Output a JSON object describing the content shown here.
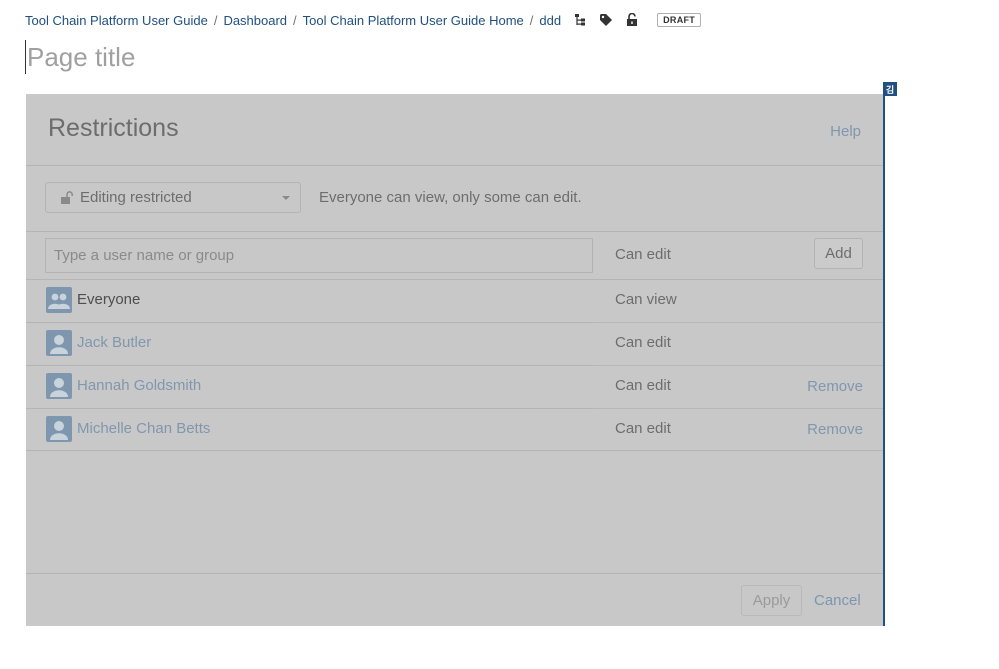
{
  "breadcrumb": {
    "items": [
      "Tool Chain Platform User Guide",
      "Dashboard",
      "Tool Chain Platform User Guide Home",
      "ddd"
    ],
    "separator": "/",
    "tools": [
      "page-tree-icon",
      "label-icon",
      "unlock-icon"
    ],
    "draft_badge": "DRAFT"
  },
  "page": {
    "title_placeholder": "Page title"
  },
  "corner_tag": "김",
  "dialog": {
    "title": "Restrictions",
    "help_label": "Help",
    "restriction_mode": "Editing restricted",
    "restriction_description": "Everyone can view, only some can edit.",
    "user_input_placeholder": "Type a user name or group",
    "permission_default": "Can edit",
    "add_label": "Add",
    "entries": [
      {
        "name": "Everyone",
        "permission": "Can view",
        "remove": "",
        "avatar": "group-avatar-icon"
      },
      {
        "name": "Jack Butler",
        "permission": "Can edit",
        "remove": "",
        "avatar": "user-avatar-icon"
      },
      {
        "name": "Hannah Goldsmith",
        "permission": "Can edit",
        "remove": "Remove",
        "avatar": "user-avatar-icon"
      },
      {
        "name": "Michelle Chan Betts",
        "permission": "Can edit",
        "remove": "Remove",
        "avatar": "user-avatar-icon"
      }
    ],
    "apply_label": "Apply",
    "cancel_label": "Cancel"
  },
  "colors": {
    "link": "#205081",
    "overlay": "#c8c8c8",
    "accent_rule": "#205081"
  }
}
